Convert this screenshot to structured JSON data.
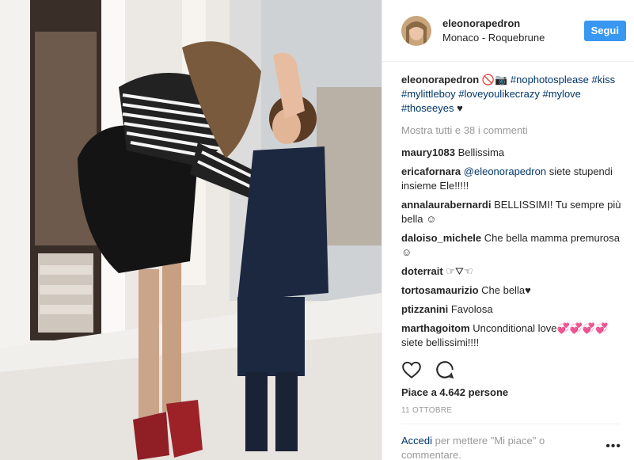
{
  "header": {
    "username": "eleonorapedron",
    "location": "Monaco - Roquebrune",
    "follow_label": "Segui"
  },
  "caption": {
    "username": "eleonorapedron",
    "emoji": "🚫📷",
    "hashtags": [
      "#nophotosplease",
      "#kiss",
      "#mylittleboy",
      "#loveyoulikecrazy",
      "#mylove",
      "#thoseeyes"
    ],
    "heart": "♥"
  },
  "show_all_comments": "Mostra tutti e 38 i commenti",
  "comments": [
    {
      "user": "maury1083",
      "text": "Bellissima"
    },
    {
      "user": "ericafornara",
      "mention": "@eleonorapedron",
      "text": "siete stupendi insieme Ele!!!!!"
    },
    {
      "user": "annalaurabernardi",
      "text": "BELLISSIMI! Tu sempre più bella ☺"
    },
    {
      "user": "daloiso_michele",
      "text": "Che bella mamma premurosa ☺"
    },
    {
      "user": "doterrait",
      "text": "☞⛛☜"
    },
    {
      "user": "tortosamaurizio",
      "text": "Che bella♥"
    },
    {
      "user": "ptizzanini",
      "text": "Favolosa"
    },
    {
      "user": "marthagoitom",
      "text": "Unconditional love💞💞💞💞 siete bellissimi!!!!"
    }
  ],
  "actions": {
    "like_icon": "heart-outline-icon",
    "comment_icon": "speech-bubble-icon"
  },
  "likes": "Piace a 4.642 persone",
  "date": "11 OTTOBRE",
  "add_comment": {
    "login_link": "Accedi",
    "text": "per mettere \"Mi piace\" o commentare."
  },
  "more_icon": "ellipsis-icon"
}
